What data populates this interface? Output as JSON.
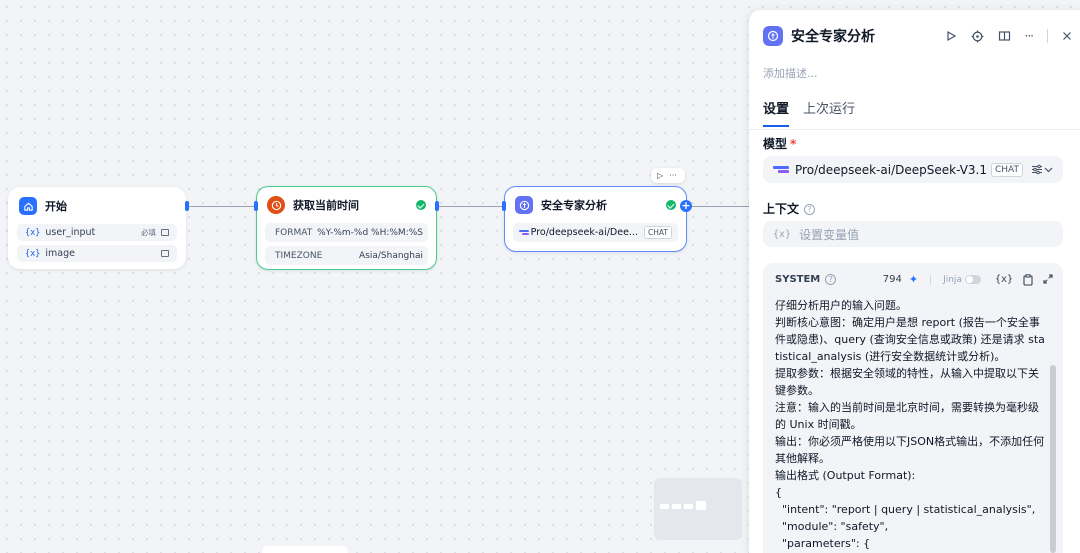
{
  "canvas": {
    "nodes": {
      "start": {
        "title": "开始",
        "vars": [
          {
            "prefix": "{x}",
            "name": "user_input",
            "required": "必填"
          },
          {
            "prefix": "{x}",
            "name": "image",
            "required": ""
          }
        ]
      },
      "time": {
        "title": "获取当前时间",
        "rows": [
          {
            "key": "FORMAT",
            "value": "%Y-%m-%d %H:%M:%S"
          },
          {
            "key": "TIMEZONE",
            "value": "Asia/Shanghai"
          }
        ]
      },
      "llm": {
        "title": "安全专家分析",
        "model": "Pro/deepseek-ai/Dee...",
        "chip": "CHAT",
        "toolbar_run": "▷",
        "toolbar_more": "···"
      }
    }
  },
  "panel": {
    "title": "安全专家分析",
    "description_placeholder": "添加描述...",
    "tabs": [
      {
        "label": "设置",
        "active": true
      },
      {
        "label": "上次运行",
        "active": false
      }
    ],
    "model_label": "模型",
    "required_mark": "*",
    "model_name": "Pro/deepseek-ai/DeepSeek-V3.1",
    "model_chip": "CHAT",
    "context_label": "上下文",
    "context_placeholder": "设置变量值",
    "context_prefix": "{x}",
    "prompt": {
      "role": "SYSTEM",
      "tokens": "794",
      "jinja_label": "Jinja",
      "var_icon": "{x}",
      "text": "仔细分析用户的输入问题。\n判断核心意图：确定用户是想 report (报告一个安全事件或隐患)、query (查询安全信息或政策) 还是请求 statistical_analysis (进行安全数据统计或分析)。\n提取参数：根据安全领域的特性，从输入中提取以下关键参数。\n注意：输入的当前时间是北京时间，需要转换为毫秒级的 Unix 时间戳。\n输出：你必须严格使用以下JSON格式输出，不添加任何其他解释。\n输出格式 (Output Format):\n{\n  \"intent\": \"report | query | statistical_analysis\",\n  \"module\": \"safety\",\n  \"parameters\": {\n    \"subject_person\": \"字符串或null\","
    },
    "colors": {
      "accent": "#155eef",
      "node_icon": "#6172f3",
      "success": "#12b76a"
    }
  }
}
